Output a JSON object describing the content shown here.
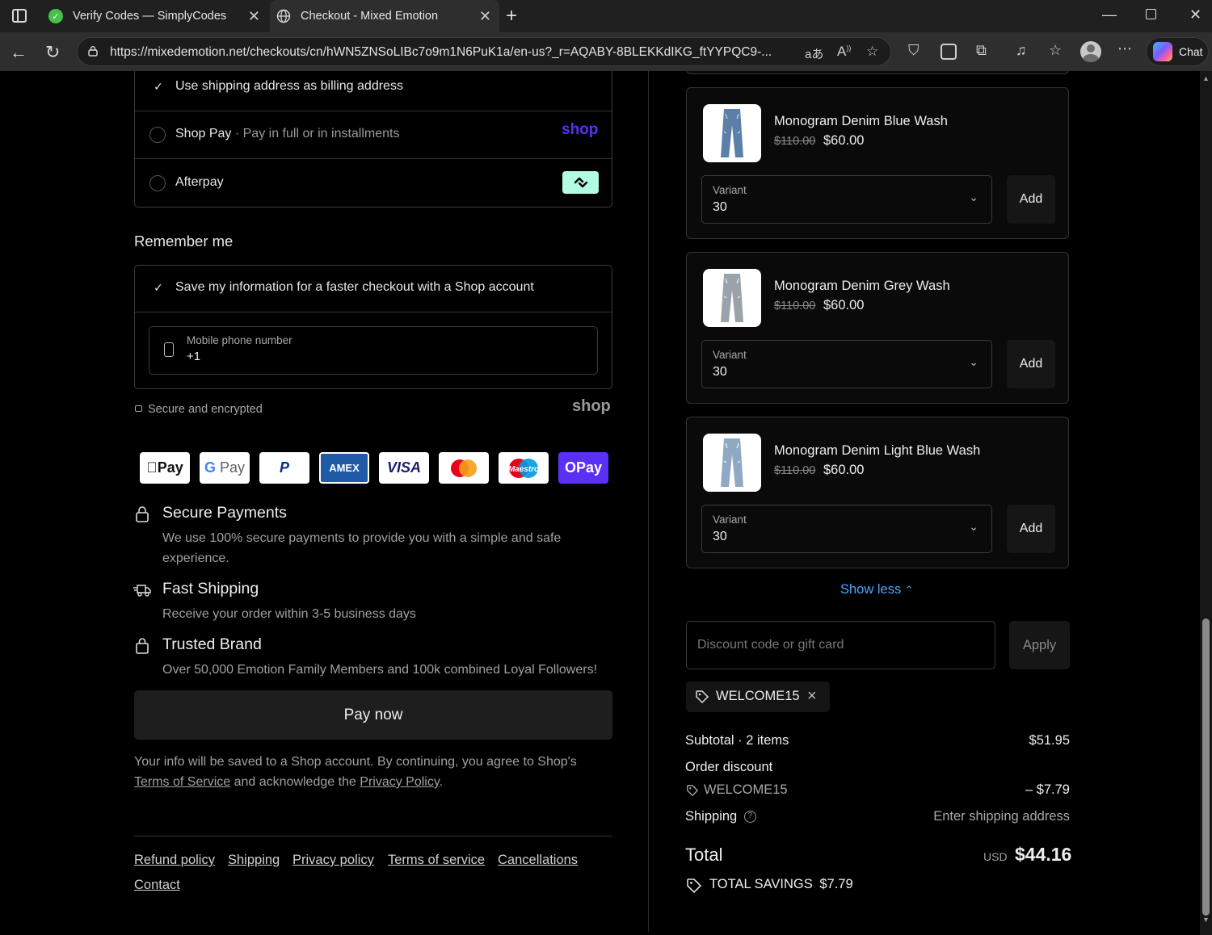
{
  "browser": {
    "tabs": [
      {
        "title": "Verify Codes — SimplyCodes",
        "active": false
      },
      {
        "title": "Checkout - Mixed Emotion",
        "active": true
      }
    ],
    "url": "https://mixedemotion.net/checkouts/cn/hWN5ZNSoLIBc7o9m1N6PuK1a/en-us?_r=AQABY-8BLEKKdIKG_ftYYPQC9-...",
    "chat_label": "Chat"
  },
  "payment_options": {
    "billing_checkbox": "Use shipping address as billing address",
    "shop_pay_label": "Shop Pay",
    "shop_pay_sub": "Pay in full or in installments",
    "shop_pay_logo": "shop",
    "afterpay_label": "Afterpay"
  },
  "remember_me": {
    "heading": "Remember me",
    "save_info": "Save my information for a faster checkout with a Shop account",
    "phone_label": "Mobile phone number",
    "phone_value": "+1",
    "secure_text": "Secure and encrypted",
    "shop_logo": "shop"
  },
  "payment_icons": [
    "Apple Pay",
    "Google Pay",
    "PayPal",
    "AMEX",
    "VISA",
    "Mastercard",
    "Maestro",
    "OPay"
  ],
  "features": [
    {
      "title": "Secure Payments",
      "desc": "We use 100% secure payments to provide you with a simple and safe experience."
    },
    {
      "title": "Fast Shipping",
      "desc": "Receive your order within 3-5 business days"
    },
    {
      "title": "Trusted Brand",
      "desc": "Over 50,000 Emotion Family Members and 100k combined Loyal Followers!"
    }
  ],
  "pay_now": "Pay now",
  "legal": {
    "text1": "Your info will be saved to a Shop account. By continuing, you agree to Shop's",
    "terms": "Terms of Service",
    "text2": "and acknowledge the",
    "privacy": "Privacy Policy",
    "end": "."
  },
  "footer_links": [
    "Refund policy",
    "Shipping",
    "Privacy policy",
    "Terms of service",
    "Cancellations",
    "Contact"
  ],
  "products": [
    {
      "name": "Monogram Denim Blue Wash",
      "old_price": "$110.00",
      "price": "$60.00",
      "variant_label": "Variant",
      "variant": "30",
      "add": "Add"
    },
    {
      "name": "Monogram Denim Grey Wash",
      "old_price": "$110.00",
      "price": "$60.00",
      "variant_label": "Variant",
      "variant": "30",
      "add": "Add"
    },
    {
      "name": "Monogram Denim Light Blue Wash",
      "old_price": "$110.00",
      "price": "$60.00",
      "variant_label": "Variant",
      "variant": "30",
      "add": "Add"
    }
  ],
  "show_less": "Show less",
  "discount": {
    "placeholder": "Discount code or gift card",
    "apply": "Apply",
    "applied_code": "WELCOME15"
  },
  "summary": {
    "subtotal_label": "Subtotal · 2 items",
    "subtotal_value": "$51.95",
    "order_discount_label": "Order discount",
    "discount_code": "WELCOME15",
    "discount_value": "– $7.79",
    "shipping_label": "Shipping",
    "shipping_value": "Enter shipping address",
    "total_label": "Total",
    "currency": "USD",
    "total_value": "$44.16",
    "savings_label": "TOTAL SAVINGS",
    "savings_value": "$7.79"
  }
}
